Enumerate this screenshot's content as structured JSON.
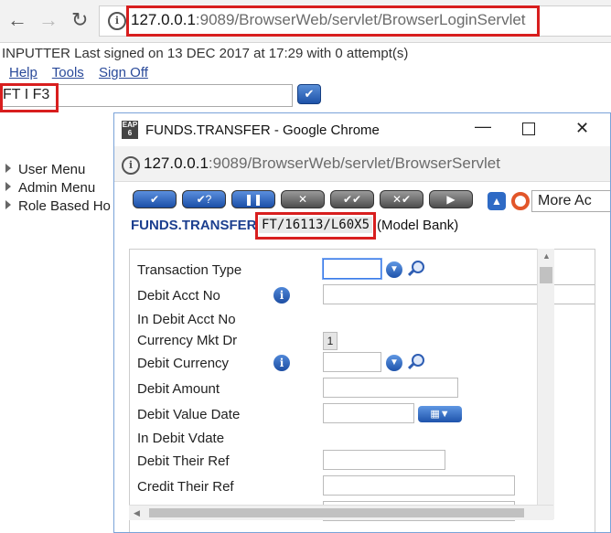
{
  "browser": {
    "url_host": "127.0.0.1",
    "url_path": ":9089/BrowserWeb/servlet/BrowserLoginServlet"
  },
  "session": {
    "signed_text": "INPUTTER Last signed on 13 DEC 2017 at 17:29 with 0 attempt(s)"
  },
  "menu_links": [
    "Help",
    "Tools",
    "Sign Off"
  ],
  "command_value": "FT I F3",
  "sidebar": [
    "User Menu",
    "Admin Menu",
    "Role Based Ho"
  ],
  "popup": {
    "app_icon_text": "EAP 6",
    "title": "FUNDS.TRANSFER - Google Chrome",
    "url_host": "127.0.0.1",
    "url_path": ":9089/BrowserWeb/servlet/BrowserServlet",
    "more_actions": "More Ac",
    "app_name": "FUNDS.TRANSFER",
    "txn_id": "FT/16113/L60X5",
    "company": "(Model Bank)",
    "form_labels": [
      "Transaction Type",
      "Debit Acct No",
      "In Debit Acct No",
      "Currency Mkt Dr",
      "Debit Currency",
      "Debit Amount",
      "Debit Value Date",
      "In Debit Vdate",
      "Debit Their Ref",
      "Credit Their Ref"
    ],
    "currency_mkt_value": "1"
  },
  "colors": {
    "highlight_red": "#d81e1e",
    "heading_blue": "#1c3f8f"
  }
}
